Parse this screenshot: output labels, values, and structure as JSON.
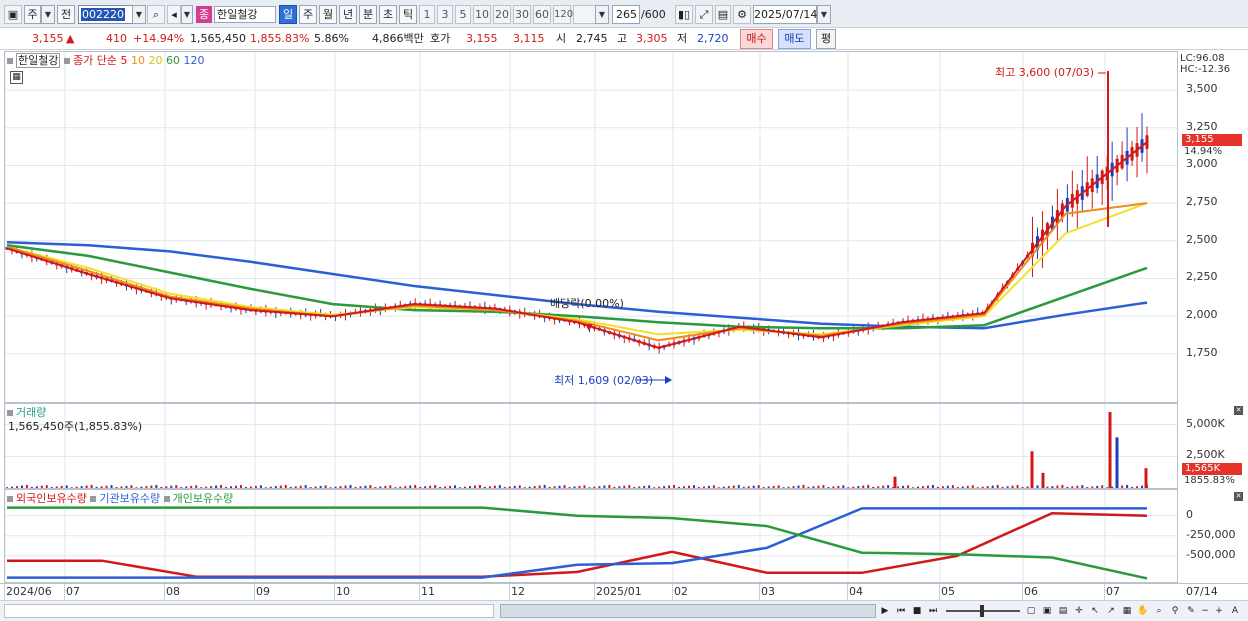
{
  "toolbar": {
    "market_label": "주",
    "prev_label": "전",
    "stock_code": "002220",
    "stock_name": "한일철강",
    "name_badge": "종",
    "periods": [
      "일",
      "주",
      "월",
      "년",
      "분",
      "초",
      "틱"
    ],
    "active_period": "일",
    "intervals": [
      "1",
      "3",
      "5",
      "10",
      "20",
      "30",
      "60",
      "120"
    ],
    "count": "265",
    "count_total": "/600",
    "date": "2025/07/14"
  },
  "quote": {
    "price": "3,155",
    "arrow": "▲",
    "change": "410",
    "change_pct": "+14.94%",
    "volume": "1,565,450",
    "volume_ratio": "1,855.83%",
    "turnover": "5.86%",
    "amount": "4,866백만",
    "hoga_label": "호가",
    "ask": "3,155",
    "bid": "3,115",
    "open_label": "시",
    "open": "2,745",
    "high_label": "고",
    "high": "3,305",
    "low_label": "저",
    "low": "2,720",
    "buy_label": "매수",
    "sell_label": "매도",
    "avg_label": "평"
  },
  "price_panel": {
    "legend_name": "한일철강",
    "legend_ma_title": "종가 단순",
    "ma_periods": [
      {
        "label": "5",
        "color": "#d11919"
      },
      {
        "label": "10",
        "color": "#f08a1c"
      },
      {
        "label": "20",
        "color": "#e8d21a"
      },
      {
        "label": "60",
        "color": "#2a9a3c"
      },
      {
        "label": "120",
        "color": "#2c5fd6"
      }
    ],
    "lc_label": "LC:96.08",
    "hc_label": "HC:-12.36",
    "high_note": "최고 3,600 (07/03)",
    "low_note": "최저 1,609 (02/03)",
    "dividend_note": "배당락(0.00%)",
    "price_tag": "3,155",
    "pct_tag": "14.94%",
    "y_ticks": [
      "3,500",
      "3,250",
      "3,000",
      "2,750",
      "2,500",
      "2,250",
      "2,000",
      "1,750"
    ],
    "y_values": [
      3500,
      3250,
      3000,
      2750,
      2500,
      2250,
      2000,
      1750
    ]
  },
  "volume_panel": {
    "title": "거래량",
    "value": "1,565,450주(1,855.83%)",
    "y_ticks": [
      "5,000K",
      "2,500K"
    ],
    "y_values": [
      5000,
      2500
    ],
    "tag_value": "1,565K",
    "tag_pct": "1855.83%"
  },
  "holdings_panel": {
    "legend": [
      {
        "label": "외국인보유수량",
        "color": "#d11919"
      },
      {
        "label": "기관보유수량",
        "color": "#2c5fd6"
      },
      {
        "label": "개인보유수량",
        "color": "#2a9a3c"
      }
    ],
    "y_ticks": [
      "0",
      "-250,000",
      "-500,000"
    ],
    "y_values": [
      0,
      -250000,
      -500000
    ]
  },
  "date_axis": {
    "labels": [
      "2024/06",
      "07",
      "08",
      "09",
      "10",
      "11",
      "12",
      "2025/01",
      "02",
      "03",
      "04",
      "05",
      "06",
      "07"
    ],
    "end_label": "07/14"
  },
  "chart_data": [
    {
      "type": "line",
      "title": "한일철강",
      "ylim": [
        1550,
        3620
      ],
      "x": [
        "2024/06",
        "07",
        "08",
        "09",
        "10",
        "11",
        "12",
        "2025/01",
        "02",
        "03",
        "04",
        "05",
        "06",
        "07",
        "07/14"
      ],
      "series": [
        {
          "name": "5",
          "values": [
            2450,
            2280,
            2120,
            2040,
            2000,
            2080,
            2050,
            1960,
            1790,
            1930,
            1860,
            1960,
            2020,
            2730,
            3155
          ]
        },
        {
          "name": "10",
          "values": [
            2460,
            2300,
            2130,
            2050,
            2000,
            2070,
            2040,
            1970,
            1840,
            1920,
            1870,
            1950,
            2010,
            2680,
            2750
          ]
        },
        {
          "name": "20",
          "values": [
            2460,
            2320,
            2150,
            2060,
            2010,
            2060,
            2040,
            1980,
            1880,
            1910,
            1880,
            1940,
            2000,
            2550,
            2750
          ]
        },
        {
          "name": "60",
          "values": [
            2470,
            2400,
            2290,
            2180,
            2080,
            2040,
            2030,
            2000,
            1960,
            1930,
            1920,
            1920,
            1940,
            2130,
            2320
          ]
        },
        {
          "name": "120",
          "values": [
            2490,
            2470,
            2430,
            2360,
            2280,
            2200,
            2140,
            2080,
            2030,
            1990,
            1950,
            1930,
            1920,
            2010,
            2090
          ]
        }
      ],
      "annotations": [
        "최고 3,600 (07/03)",
        "최저 1,609 (02/03)",
        "배당락(0.00%)"
      ]
    },
    {
      "type": "bar",
      "title": "거래량",
      "unit": "K",
      "ylim": [
        0,
        6000
      ],
      "x": [
        "04",
        "06",
        "07a",
        "07b",
        "07c",
        "07/14"
      ],
      "values": [
        900,
        2900,
        1200,
        6000,
        4000,
        1565
      ]
    },
    {
      "type": "line",
      "title": "보유수량",
      "ylim": [
        -800000,
        120000
      ],
      "x": [
        "2024/06",
        "08",
        "09",
        "12",
        "2025/01",
        "02",
        "03",
        "04",
        "05",
        "06",
        "07",
        "07/14"
      ],
      "series": [
        {
          "name": "외국인보유수량",
          "values": [
            -560000,
            -560000,
            -760000,
            -760000,
            -760000,
            -760000,
            -700000,
            -450000,
            -710000,
            -710000,
            -500000,
            30000,
            0
          ]
        },
        {
          "name": "기관보유수량",
          "values": [
            -770000,
            -770000,
            -770000,
            -770000,
            -770000,
            -770000,
            -610000,
            -590000,
            -400000,
            90000,
            90000,
            90000,
            90000
          ]
        },
        {
          "name": "개인보유수량",
          "values": [
            100000,
            100000,
            100000,
            100000,
            100000,
            100000,
            0,
            -30000,
            -130000,
            -460000,
            -480000,
            -520000,
            -780000
          ]
        }
      ]
    }
  ]
}
